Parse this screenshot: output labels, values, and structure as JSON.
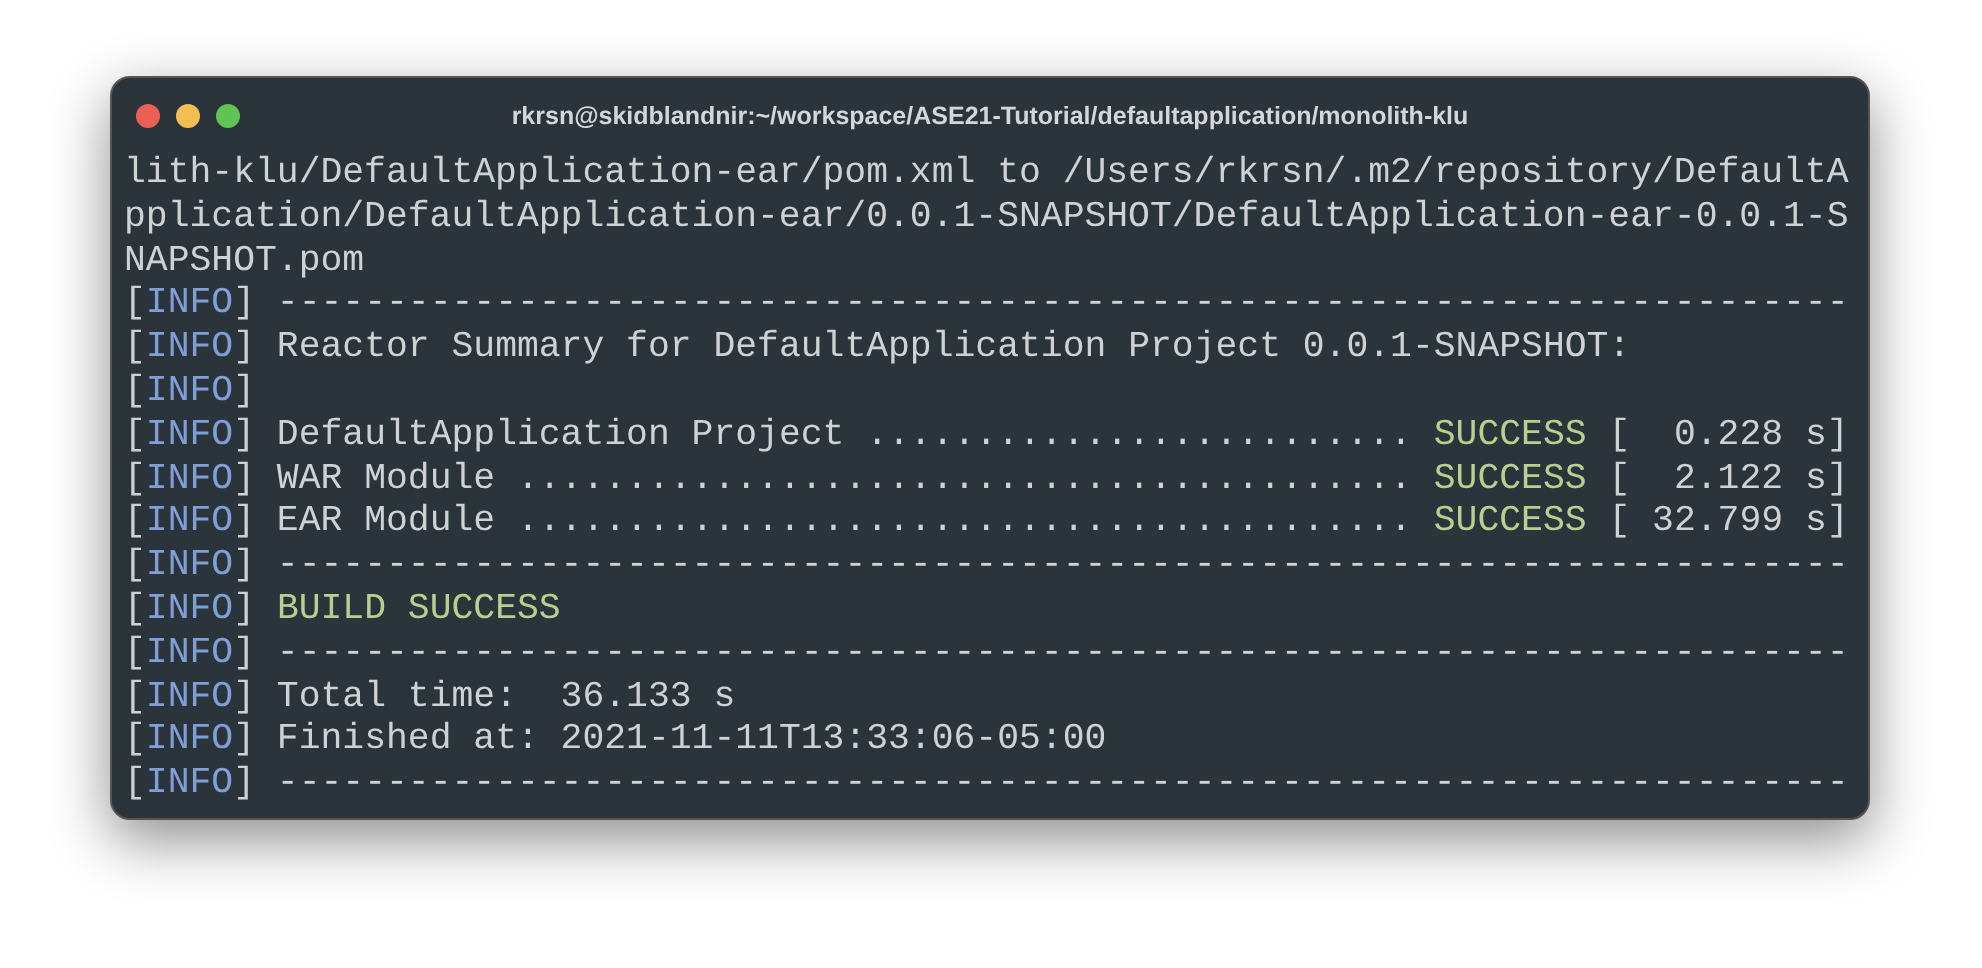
{
  "window": {
    "title": "rkrsn@skidblandnir:~/workspace/ASE21-Tutorial/defaultapplication/monolith-klu"
  },
  "lines": [
    [
      {
        "kind": "plain",
        "text": "lith-klu/DefaultApplication-ear/pom.xml to /Users/rkrsn/.m2/repository/DefaultA"
      }
    ],
    [
      {
        "kind": "plain",
        "text": "pplication/DefaultApplication-ear/0.0.1-SNAPSHOT/DefaultApplication-ear-0.0.1-S"
      }
    ],
    [
      {
        "kind": "plain",
        "text": "NAPSHOT.pom"
      }
    ],
    [
      {
        "kind": "plain",
        "text": "["
      },
      {
        "kind": "tag",
        "text": "INFO"
      },
      {
        "kind": "plain",
        "text": "] ------------------------------------------------------------------------"
      }
    ],
    [
      {
        "kind": "plain",
        "text": "["
      },
      {
        "kind": "tag",
        "text": "INFO"
      },
      {
        "kind": "plain",
        "text": "] Reactor Summary for DefaultApplication Project 0.0.1-SNAPSHOT:"
      }
    ],
    [
      {
        "kind": "plain",
        "text": "["
      },
      {
        "kind": "tag",
        "text": "INFO"
      },
      {
        "kind": "plain",
        "text": "]"
      }
    ],
    [
      {
        "kind": "plain",
        "text": "["
      },
      {
        "kind": "tag",
        "text": "INFO"
      },
      {
        "kind": "plain",
        "text": "] DefaultApplication Project ......................... "
      },
      {
        "kind": "success",
        "text": "SUCCESS"
      },
      {
        "kind": "plain",
        "text": " [  0.228 s]"
      }
    ],
    [
      {
        "kind": "plain",
        "text": "["
      },
      {
        "kind": "tag",
        "text": "INFO"
      },
      {
        "kind": "plain",
        "text": "] WAR Module ......................................... "
      },
      {
        "kind": "success",
        "text": "SUCCESS"
      },
      {
        "kind": "plain",
        "text": " [  2.122 s]"
      }
    ],
    [
      {
        "kind": "plain",
        "text": "["
      },
      {
        "kind": "tag",
        "text": "INFO"
      },
      {
        "kind": "plain",
        "text": "] EAR Module ......................................... "
      },
      {
        "kind": "success",
        "text": "SUCCESS"
      },
      {
        "kind": "plain",
        "text": " [ 32.799 s]"
      }
    ],
    [
      {
        "kind": "plain",
        "text": "["
      },
      {
        "kind": "tag",
        "text": "INFO"
      },
      {
        "kind": "plain",
        "text": "] ------------------------------------------------------------------------"
      }
    ],
    [
      {
        "kind": "plain",
        "text": "["
      },
      {
        "kind": "tag",
        "text": "INFO"
      },
      {
        "kind": "plain",
        "text": "] "
      },
      {
        "kind": "success",
        "text": "BUILD SUCCESS"
      }
    ],
    [
      {
        "kind": "plain",
        "text": "["
      },
      {
        "kind": "tag",
        "text": "INFO"
      },
      {
        "kind": "plain",
        "text": "] ------------------------------------------------------------------------"
      }
    ],
    [
      {
        "kind": "plain",
        "text": "["
      },
      {
        "kind": "tag",
        "text": "INFO"
      },
      {
        "kind": "plain",
        "text": "] Total time:  36.133 s"
      }
    ],
    [
      {
        "kind": "plain",
        "text": "["
      },
      {
        "kind": "tag",
        "text": "INFO"
      },
      {
        "kind": "plain",
        "text": "] Finished at: 2021-11-11T13:33:06-05:00"
      }
    ],
    [
      {
        "kind": "plain",
        "text": "["
      },
      {
        "kind": "tag",
        "text": "INFO"
      },
      {
        "kind": "plain",
        "text": "] ------------------------------------------------------------------------"
      }
    ]
  ]
}
